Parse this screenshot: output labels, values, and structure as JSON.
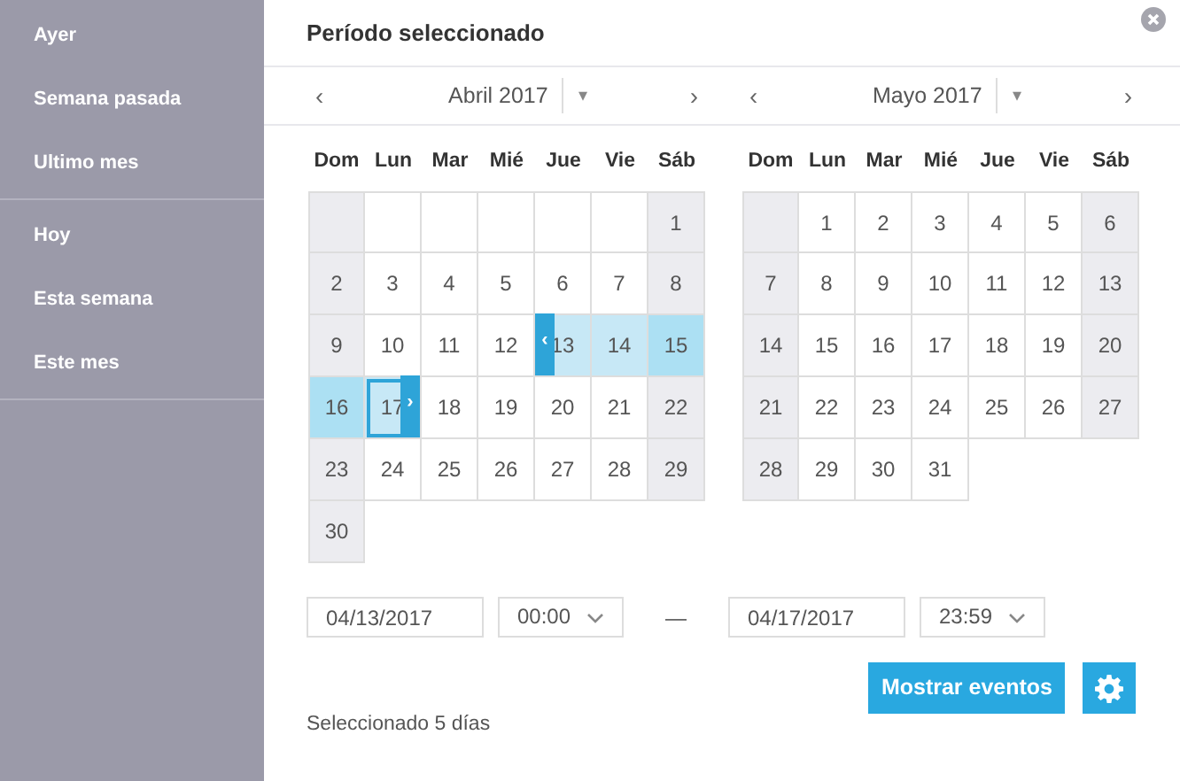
{
  "sidebar": {
    "groups": [
      {
        "items": [
          {
            "label": "Ayer",
            "selected": false
          },
          {
            "label": "Semana pasada",
            "selected": false
          },
          {
            "label": "Ultimo mes",
            "selected": false
          }
        ]
      },
      {
        "items": [
          {
            "label": "Hoy",
            "selected": false
          },
          {
            "label": "Esta semana",
            "selected": false
          },
          {
            "label": "Este mes",
            "selected": false
          }
        ]
      }
    ]
  },
  "title": "Período seleccionado",
  "months": [
    {
      "label": "Abril 2017",
      "prev": "‹",
      "caret": "▾",
      "next": "›",
      "weekdays": [
        "Dom",
        "Lun",
        "Mar",
        "Mié",
        "Jue",
        "Vie",
        "Sáb"
      ],
      "days": [
        {
          "kind": "blank"
        },
        {
          "kind": "blank"
        },
        {
          "kind": "blank"
        },
        {
          "kind": "blank"
        },
        {
          "kind": "blank"
        },
        {
          "kind": "blank"
        },
        {
          "kind": "day",
          "day": "1",
          "selected": false
        },
        {
          "kind": "day",
          "day": "2",
          "selected": false
        },
        {
          "kind": "day",
          "day": "3",
          "selected": false
        },
        {
          "kind": "day",
          "day": "4",
          "selected": false
        },
        {
          "kind": "day",
          "day": "5",
          "selected": false
        },
        {
          "kind": "day",
          "day": "6",
          "selected": false
        },
        {
          "kind": "day",
          "day": "7",
          "selected": false
        },
        {
          "kind": "day",
          "day": "8",
          "selected": false
        },
        {
          "kind": "day",
          "day": "9",
          "selected": false
        },
        {
          "kind": "day",
          "day": "10",
          "selected": false
        },
        {
          "kind": "day",
          "day": "11",
          "selected": false
        },
        {
          "kind": "day",
          "day": "12",
          "selected": false
        },
        {
          "kind": "day",
          "day": "13",
          "selected": true,
          "handle": {
            "kind": "start",
            "label": "‹"
          }
        },
        {
          "kind": "day",
          "day": "14",
          "selected": true
        },
        {
          "kind": "day",
          "day": "15",
          "selected": true
        },
        {
          "kind": "day",
          "day": "16",
          "selected": true
        },
        {
          "kind": "day",
          "day": "17",
          "selected": true,
          "focused": true,
          "handle": {
            "kind": "end",
            "label": "›"
          }
        },
        {
          "kind": "day",
          "day": "18",
          "selected": false
        },
        {
          "kind": "day",
          "day": "19",
          "selected": false
        },
        {
          "kind": "day",
          "day": "20",
          "selected": false
        },
        {
          "kind": "day",
          "day": "21",
          "selected": false
        },
        {
          "kind": "day",
          "day": "22",
          "selected": false
        },
        {
          "kind": "day",
          "day": "23",
          "selected": false
        },
        {
          "kind": "day",
          "day": "24",
          "selected": false
        },
        {
          "kind": "day",
          "day": "25",
          "selected": false
        },
        {
          "kind": "day",
          "day": "26",
          "selected": false
        },
        {
          "kind": "day",
          "day": "27",
          "selected": false
        },
        {
          "kind": "day",
          "day": "28",
          "selected": false
        },
        {
          "kind": "day",
          "day": "29",
          "selected": false
        },
        {
          "kind": "day",
          "day": "30",
          "selected": false
        }
      ]
    },
    {
      "label": "Mayo 2017",
      "prev": "‹",
      "caret": "▾",
      "next": "›",
      "weekdays": [
        "Dom",
        "Lun",
        "Mar",
        "Mié",
        "Jue",
        "Vie",
        "Sáb"
      ],
      "days": [
        {
          "kind": "blank"
        },
        {
          "kind": "day",
          "day": "1",
          "selected": false
        },
        {
          "kind": "day",
          "day": "2",
          "selected": false
        },
        {
          "kind": "day",
          "day": "3",
          "selected": false
        },
        {
          "kind": "day",
          "day": "4",
          "selected": false
        },
        {
          "kind": "day",
          "day": "5",
          "selected": false
        },
        {
          "kind": "day",
          "day": "6",
          "selected": false
        },
        {
          "kind": "day",
          "day": "7",
          "selected": false
        },
        {
          "kind": "day",
          "day": "8",
          "selected": false
        },
        {
          "kind": "day",
          "day": "9",
          "selected": false
        },
        {
          "kind": "day",
          "day": "10",
          "selected": false
        },
        {
          "kind": "day",
          "day": "11",
          "selected": false
        },
        {
          "kind": "day",
          "day": "12",
          "selected": false
        },
        {
          "kind": "day",
          "day": "13",
          "selected": false
        },
        {
          "kind": "day",
          "day": "14",
          "selected": false
        },
        {
          "kind": "day",
          "day": "15",
          "selected": false
        },
        {
          "kind": "day",
          "day": "16",
          "selected": false
        },
        {
          "kind": "day",
          "day": "17",
          "selected": false
        },
        {
          "kind": "day",
          "day": "18",
          "selected": false
        },
        {
          "kind": "day",
          "day": "19",
          "selected": false
        },
        {
          "kind": "day",
          "day": "20",
          "selected": false
        },
        {
          "kind": "day",
          "day": "21",
          "selected": false
        },
        {
          "kind": "day",
          "day": "22",
          "selected": false
        },
        {
          "kind": "day",
          "day": "23",
          "selected": false
        },
        {
          "kind": "day",
          "day": "24",
          "selected": false
        },
        {
          "kind": "day",
          "day": "25",
          "selected": false
        },
        {
          "kind": "day",
          "day": "26",
          "selected": false
        },
        {
          "kind": "day",
          "day": "27",
          "selected": false
        },
        {
          "kind": "day",
          "day": "28",
          "selected": false
        },
        {
          "kind": "day",
          "day": "29",
          "selected": false
        },
        {
          "kind": "day",
          "day": "30",
          "selected": false
        },
        {
          "kind": "day",
          "day": "31",
          "selected": false
        }
      ]
    }
  ],
  "start": {
    "date": "04/13/2017",
    "time": "00:00"
  },
  "separator": "—",
  "end": {
    "date": "04/17/2017",
    "time": "23:59"
  },
  "show_button": "Mostrar eventos",
  "summary": "Seleccionado 5 días"
}
